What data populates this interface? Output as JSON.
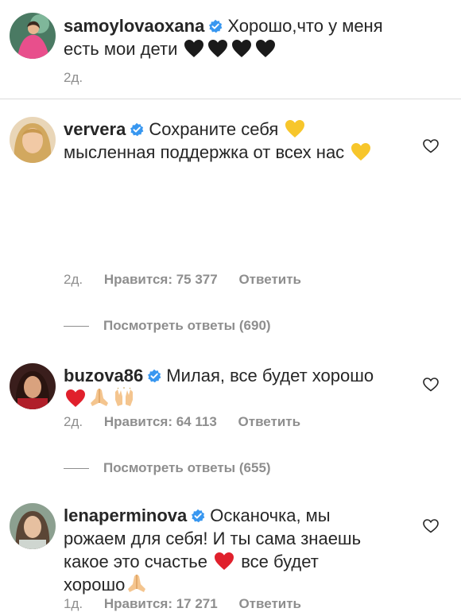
{
  "caption": {
    "username": "samoylovaoxana",
    "text": "Хорошо,что у меня есть мои дети",
    "emojis": [
      "black-heart",
      "black-heart",
      "black-heart",
      "black-heart"
    ],
    "time": "2д."
  },
  "comments": [
    {
      "username": "ververa",
      "text_line1": "Сохраните себя",
      "text_line2": "мысленная поддержка от всех нас",
      "time": "2д.",
      "likes": "Нравится: 75 377",
      "reply": "Ответить",
      "view_replies": "Посмотреть ответы (690)"
    },
    {
      "username": "buzova86",
      "text_line1": "Милая, все будет хорошо",
      "time": "2д.",
      "likes": "Нравится: 64 113",
      "reply": "Ответить",
      "view_replies": "Посмотреть ответы (655)"
    },
    {
      "username": "lenaperminova",
      "text_line1": "Осканочка, мы",
      "text_line2": "рожаем для себя! И ты сама знаешь",
      "text_line3a": "какое это счастье",
      "text_line3b": "все будет",
      "text_line4": "хорошо",
      "time": "1д.",
      "likes": "Нравится: 17 271",
      "reply": "Ответить"
    }
  ],
  "colors": {
    "username": "#262626",
    "meta": "#8e8e8e",
    "verified": "#3897f0",
    "divider": "#dbdbdb"
  }
}
